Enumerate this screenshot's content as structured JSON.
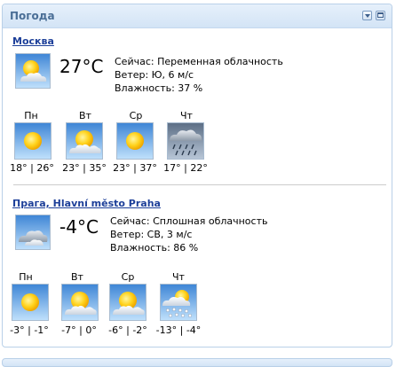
{
  "gadget": {
    "title": "Погода"
  },
  "cities": [
    {
      "name": "Москва",
      "temp": "27°C",
      "now": "Сейчас: Переменная облачность",
      "wind": "Ветер: Ю, 6 м/с",
      "humidity": "Влажность: 37 %",
      "icon": "partly-cloudy-icon",
      "forecast": [
        {
          "day": "Пн",
          "range": "18° | 26°",
          "icon": "sunny-icon"
        },
        {
          "day": "Вт",
          "range": "23° | 35°",
          "icon": "partly-cloudy-icon"
        },
        {
          "day": "Ср",
          "range": "23° | 37°",
          "icon": "sunny-icon"
        },
        {
          "day": "Чт",
          "range": "17° | 22°",
          "icon": "rain-icon"
        }
      ]
    },
    {
      "name": "Прага, Hlavní město Praha",
      "temp": "-4°C",
      "now": "Сейчас: Сплошная облачность",
      "wind": "Ветер: СВ, 3 м/с",
      "humidity": "Влажность: 86 %",
      "icon": "overcast-icon",
      "forecast": [
        {
          "day": "Пн",
          "range": "-3° | -1°",
          "icon": "sunny-icon"
        },
        {
          "day": "Вт",
          "range": "-7° | 0°",
          "icon": "partly-cloudy-icon"
        },
        {
          "day": "Ср",
          "range": "-6° | -2°",
          "icon": "partly-cloudy-icon"
        },
        {
          "day": "Чт",
          "range": "-13° | -4°",
          "icon": "snow-sun-icon"
        }
      ]
    }
  ]
}
